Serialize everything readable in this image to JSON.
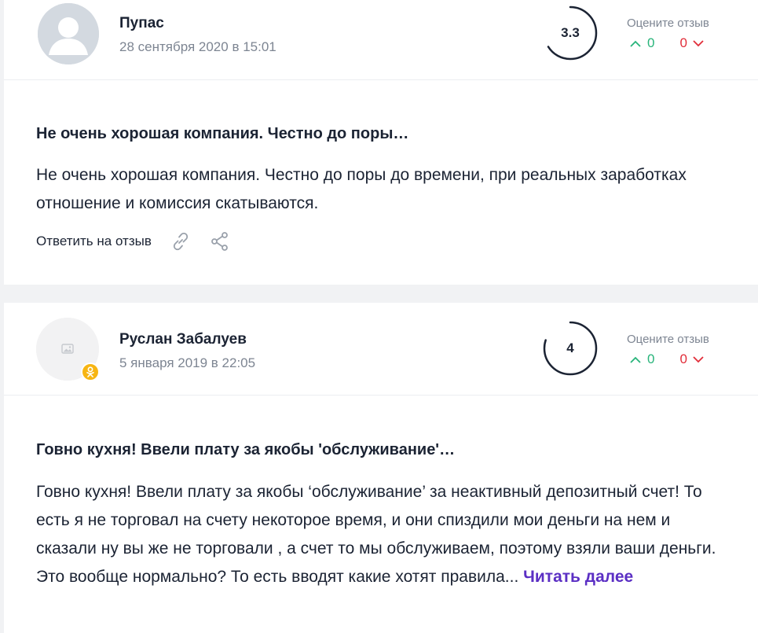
{
  "rate_prompt": "Оцените отзыв",
  "reviews": [
    {
      "author": "Пупас",
      "date": "28 сентября 2020 в 15:01",
      "score": "3.3",
      "score_fraction": 0.66,
      "votes_up": "0",
      "votes_down": "0",
      "title": "Не очень хорошая компания. Честно до поры…",
      "text": "Не очень хорошая компания. Честно до поры до времени, при реальных заработках отношение и комиссия скатываются.",
      "reply_label": "Ответить на отзыв",
      "icons": [
        "link-icon",
        "share-icon"
      ]
    },
    {
      "author": "Руслан Забалуев",
      "date": "5 января 2019 в 22:05",
      "score": "4",
      "score_fraction": 0.8,
      "votes_up": "0",
      "votes_down": "0",
      "title": "Говно кухня! Ввели плату за якобы 'обслуживание'…",
      "text": "Говно кухня! Ввели плату за якобы ‘обслуживание’ за неактивный депозитный счет! То есть я не торговал на счету некоторое время, и они спиздили мои деньги на нем и сказали ну вы же не торговали , а счет то мы обслуживаем, поэтому взяли ваши деньги. Это вообще нормально? То есть вводят какие хотят правила...",
      "read_more": "Читать далее",
      "social_badge": "odnoklassniki-icon"
    }
  ],
  "colors": {
    "up": "#28b47a",
    "down": "#e12d39",
    "link": "#5b2fc4",
    "ring": "#1b2333",
    "badge": "#f7b512"
  }
}
